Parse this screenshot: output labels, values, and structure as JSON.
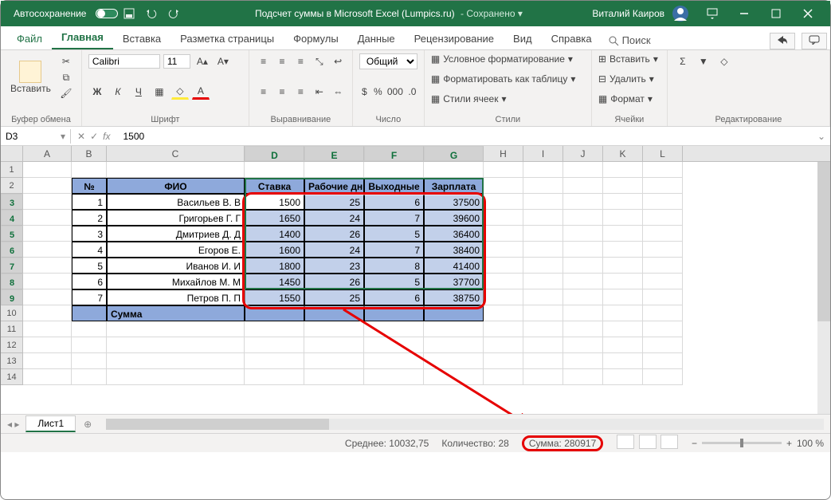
{
  "titlebar": {
    "autosave": "Автосохранение",
    "doc_title": "Подсчет суммы в Microsoft Excel (Lumpics.ru)",
    "saved": "Сохранено",
    "user": "Виталий Каиров"
  },
  "tabs": {
    "file": "Файл",
    "home": "Главная",
    "insert": "Вставка",
    "layout": "Разметка страницы",
    "formulas": "Формулы",
    "data": "Данные",
    "review": "Рецензирование",
    "view": "Вид",
    "help": "Справка",
    "search": "Поиск"
  },
  "ribbon": {
    "clipboard": {
      "paste": "Вставить",
      "label": "Буфер обмена"
    },
    "font": {
      "name": "Calibri",
      "size": "11",
      "label": "Шрифт"
    },
    "align": {
      "label": "Выравнивание"
    },
    "number": {
      "format": "Общий",
      "label": "Число"
    },
    "styles": {
      "cond": "Условное форматирование",
      "table": "Форматировать как таблицу",
      "cell": "Стили ячеек",
      "label": "Стили"
    },
    "cells": {
      "insert": "Вставить",
      "delete": "Удалить",
      "format": "Формат",
      "label": "Ячейки"
    },
    "editing": {
      "label": "Редактирование"
    }
  },
  "formula_bar": {
    "name_box": "D3",
    "formula": "1500"
  },
  "columns": [
    "A",
    "B",
    "C",
    "D",
    "E",
    "F",
    "G",
    "H",
    "I",
    "J",
    "K",
    "L"
  ],
  "table": {
    "headers": {
      "num": "№",
      "fio": "ФИО",
      "rate": "Ставка",
      "days": "Рабочие дни",
      "weekend": "Выходные",
      "salary": "Зарплата"
    },
    "rows": [
      {
        "n": "1",
        "fio": "Васильев В. В",
        "rate": "1500",
        "days": "25",
        "we": "6",
        "sal": "37500"
      },
      {
        "n": "2",
        "fio": "Григорьев Г. Г",
        "rate": "1650",
        "days": "24",
        "we": "7",
        "sal": "39600"
      },
      {
        "n": "3",
        "fio": "Дмитриев Д. Д",
        "rate": "1400",
        "days": "26",
        "we": "5",
        "sal": "36400"
      },
      {
        "n": "4",
        "fio": "Егоров Е.",
        "rate": "1600",
        "days": "24",
        "we": "7",
        "sal": "38400"
      },
      {
        "n": "5",
        "fio": "Иванов И. И",
        "rate": "1800",
        "days": "23",
        "we": "8",
        "sal": "41400"
      },
      {
        "n": "6",
        "fio": "Михайлов М. М",
        "rate": "1450",
        "days": "26",
        "we": "5",
        "sal": "37700"
      },
      {
        "n": "7",
        "fio": "Петров П. П",
        "rate": "1550",
        "days": "25",
        "we": "6",
        "sal": "38750"
      }
    ],
    "sum_label": "Сумма"
  },
  "sheet": {
    "name": "Лист1"
  },
  "statusbar": {
    "avg": "Среднее: 10032,75",
    "count": "Количество: 28",
    "sum": "Сумма: 280917",
    "zoom": "100 %"
  }
}
